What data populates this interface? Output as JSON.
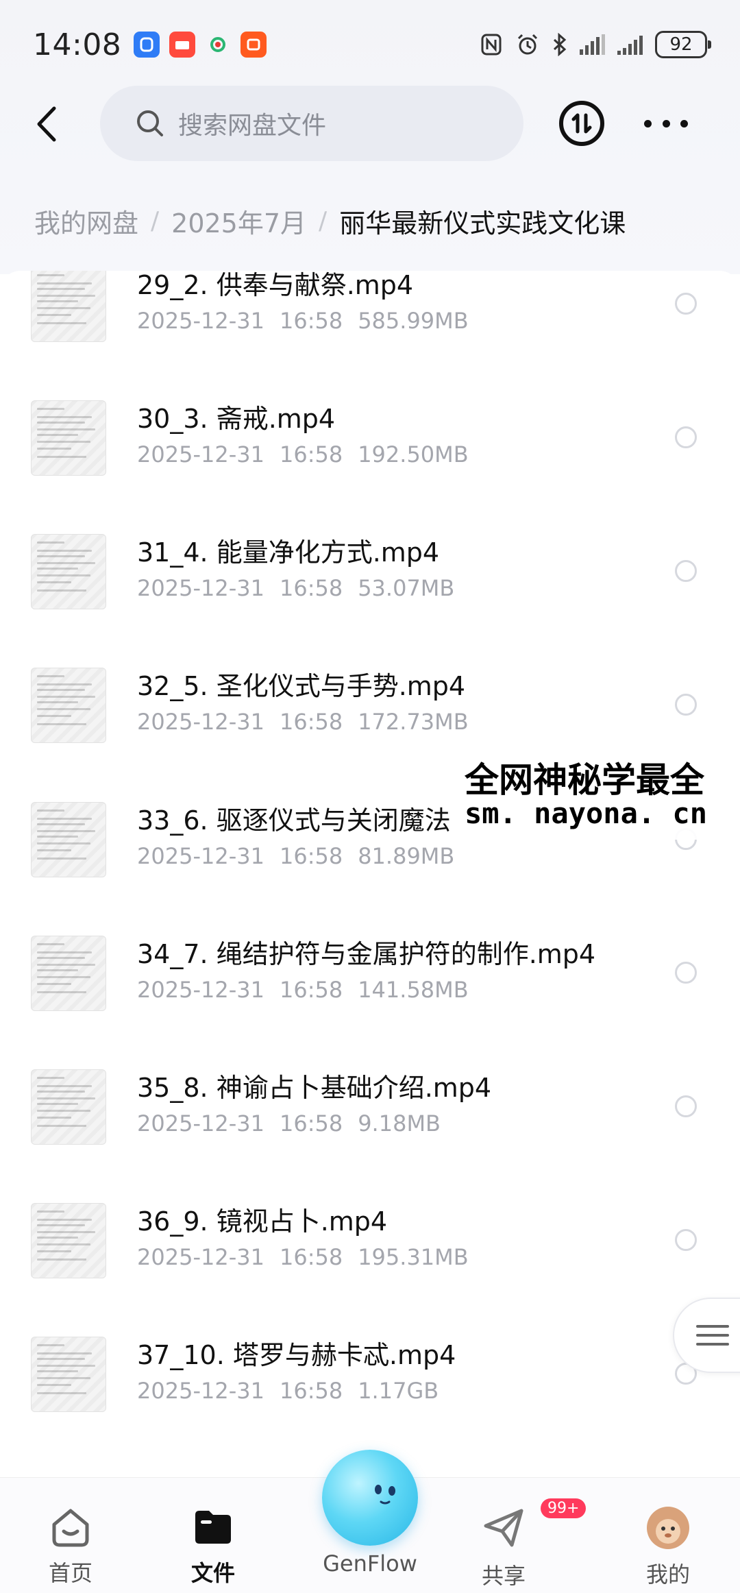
{
  "status_bar": {
    "time": "14:08",
    "battery": "92"
  },
  "header": {
    "search_placeholder": "搜索网盘文件"
  },
  "breadcrumb": {
    "items": [
      "我的网盘",
      "2025年7月",
      "丽华最新仪式实践文化课"
    ]
  },
  "files": [
    {
      "name": "29_2. 供奉与献祭.mp4",
      "date": "2025-12-31",
      "time": "16:58",
      "size": "585.99MB"
    },
    {
      "name": "30_3. 斋戒.mp4",
      "date": "2025-12-31",
      "time": "16:58",
      "size": "192.50MB"
    },
    {
      "name": "31_4. 能量净化方式.mp4",
      "date": "2025-12-31",
      "time": "16:58",
      "size": "53.07MB"
    },
    {
      "name": "32_5. 圣化仪式与手势.mp4",
      "date": "2025-12-31",
      "time": "16:58",
      "size": "172.73MB"
    },
    {
      "name": "33_6. 驱逐仪式与关闭魔法",
      "date": "2025-12-31",
      "time": "16:58",
      "size": "81.89MB"
    },
    {
      "name": "34_7. 绳结护符与金属护符的制作.mp4",
      "date": "2025-12-31",
      "time": "16:58",
      "size": "141.58MB"
    },
    {
      "name": "35_8. 神谕占卜基础介绍.mp4",
      "date": "2025-12-31",
      "time": "16:58",
      "size": "9.18MB"
    },
    {
      "name": "36_9. 镜视占卜.mp4",
      "date": "2025-12-31",
      "time": "16:58",
      "size": "195.31MB"
    },
    {
      "name": "37_10. 塔罗与赫卡忒.mp4",
      "date": "2025-12-31",
      "time": "16:58",
      "size": "1.17GB"
    }
  ],
  "watermark": {
    "line1": "全网神秘学最全",
    "line2": "sm. nayona. cn"
  },
  "bottom_nav": {
    "home": "首页",
    "files": "文件",
    "genflow": "GenFlow",
    "share": "共享",
    "share_badge": "99+",
    "mine": "我的"
  }
}
